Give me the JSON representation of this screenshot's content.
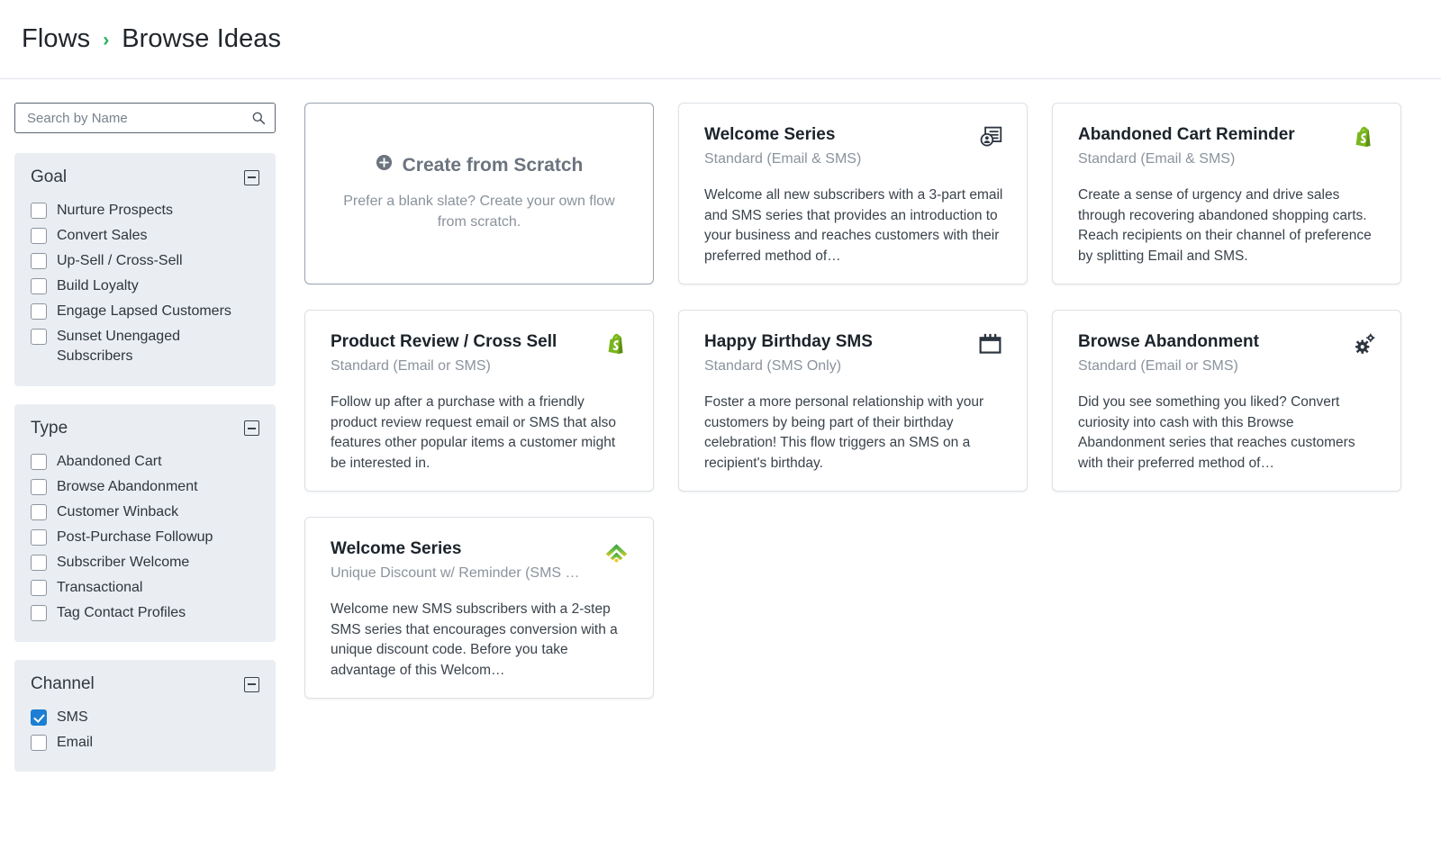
{
  "header": {
    "breadcrumb": [
      "Flows",
      "Browse Ideas"
    ],
    "separator": "›",
    "separator_color": "#24b358"
  },
  "search": {
    "placeholder": "Search by Name",
    "value": "",
    "icon": "search-icon"
  },
  "filters": [
    {
      "id": "goal",
      "title": "Goal",
      "collapse_icon": "minus-square-icon",
      "options": [
        {
          "label": "Nurture Prospects",
          "checked": false
        },
        {
          "label": "Convert Sales",
          "checked": false
        },
        {
          "label": "Up-Sell / Cross-Sell",
          "checked": false
        },
        {
          "label": "Build Loyalty",
          "checked": false
        },
        {
          "label": "Engage Lapsed Customers",
          "checked": false
        },
        {
          "label": "Sunset Unengaged Subscribers",
          "checked": false
        }
      ]
    },
    {
      "id": "type",
      "title": "Type",
      "collapse_icon": "minus-square-icon",
      "options": [
        {
          "label": "Abandoned Cart",
          "checked": false
        },
        {
          "label": "Browse Abandonment",
          "checked": false
        },
        {
          "label": "Customer Winback",
          "checked": false
        },
        {
          "label": "Post-Purchase Followup",
          "checked": false
        },
        {
          "label": "Subscriber Welcome",
          "checked": false
        },
        {
          "label": "Transactional",
          "checked": false
        },
        {
          "label": "Tag Contact Profiles",
          "checked": false
        }
      ]
    },
    {
      "id": "channel",
      "title": "Channel",
      "collapse_icon": "minus-square-icon",
      "options": [
        {
          "label": "SMS",
          "checked": true
        },
        {
          "label": "Email",
          "checked": false
        }
      ]
    }
  ],
  "scratch_card": {
    "title": "Create from Scratch",
    "description": "Prefer a blank slate? Create your own flow from scratch.",
    "icon": "plus-circle-icon"
  },
  "cards": [
    {
      "title": "Welcome Series",
      "subtitle": "Standard (Email & SMS)",
      "description": "Welcome all new subscribers with a 3-part email and SMS series that provides an introduction to your business and reaches customers with their preferred method of…",
      "icon": "contact-card-icon"
    },
    {
      "title": "Abandoned Cart Reminder",
      "subtitle": "Standard (Email & SMS)",
      "description": "Create a sense of urgency and drive sales through recovering abandoned shopping carts. Reach recipients on their channel of preference by splitting Email and SMS.",
      "icon": "shopify-icon"
    },
    {
      "title": "Product Review / Cross Sell",
      "subtitle": "Standard (Email or SMS)",
      "description": "Follow up after a purchase with a friendly product review request email or SMS that also features other popular items a customer might be interested in.",
      "icon": "shopify-icon"
    },
    {
      "title": "Happy Birthday SMS",
      "subtitle": "Standard (SMS Only)",
      "description": "Foster a more personal relationship with your customers by being part of their birthday celebration! This flow triggers an SMS on a recipient's birthday.",
      "icon": "calendar-icon"
    },
    {
      "title": "Browse Abandonment",
      "subtitle": "Standard (Email or SMS)",
      "description": "Did you see something you liked? Convert curiosity into cash with this Browse Abandonment series that reaches customers with their preferred method of…",
      "icon": "gears-icon"
    },
    {
      "title": "Welcome Series",
      "subtitle": "Unique Discount w/ Reminder (SMS …",
      "description": "Welcome new SMS subscribers with a 2-step SMS series that encourages conversion with a unique discount code. Before you take advantage of this Welcom…",
      "icon": "signal-arc-icon"
    }
  ],
  "colors": {
    "accent_green": "#24b358",
    "checkbox_blue": "#1c7fd3",
    "shopify_green": "#7ab51d",
    "panel_bg": "#eaeef2"
  }
}
